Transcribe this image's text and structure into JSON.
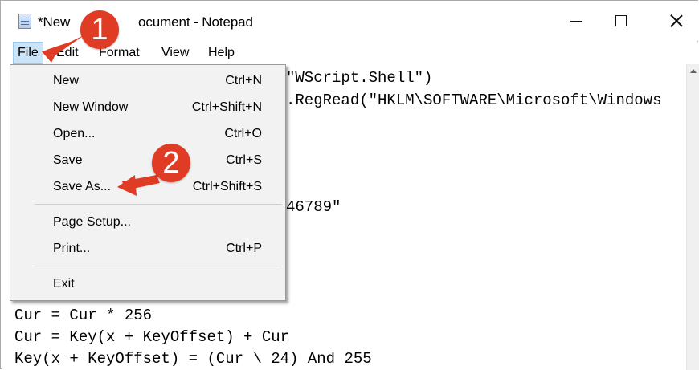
{
  "window": {
    "title": "*New Text Document - Notepad",
    "title_visible_left": "*New",
    "title_visible_right": "ocument - Notepad"
  },
  "menubar": {
    "file": "File",
    "edit": "Edit",
    "format": "Format",
    "view": "View",
    "help": "Help"
  },
  "file_menu": {
    "items": [
      {
        "label": "New",
        "shortcut": "Ctrl+N"
      },
      {
        "label": "New Window",
        "shortcut": "Ctrl+Shift+N"
      },
      {
        "label": "Open...",
        "shortcut": "Ctrl+O"
      },
      {
        "label": "Save",
        "shortcut": "Ctrl+S"
      },
      {
        "label": "Save As...",
        "shortcut": "Ctrl+Shift+S"
      },
      {
        "label": "Page Setup...",
        "shortcut": ""
      },
      {
        "label": "Print...",
        "shortcut": "Ctrl+P"
      },
      {
        "label": "Exit",
        "shortcut": ""
      }
    ]
  },
  "editor": {
    "lines_right": [
      "\"WScript.Shell\")",
      ".RegRead(\"HKLM\\SOFTWARE\\Microsoft\\Windows",
      "46789\""
    ],
    "lines_full": [
      "Cur = Cur * 256",
      "Cur = Key(x + KeyOffset) + Cur",
      "Key(x + KeyOffset) = (Cur \\ 24) And 255"
    ]
  },
  "callouts": {
    "one": "1",
    "two": "2"
  },
  "colors": {
    "callout": "#e03b24",
    "menu_highlight": "#cce4f7"
  }
}
